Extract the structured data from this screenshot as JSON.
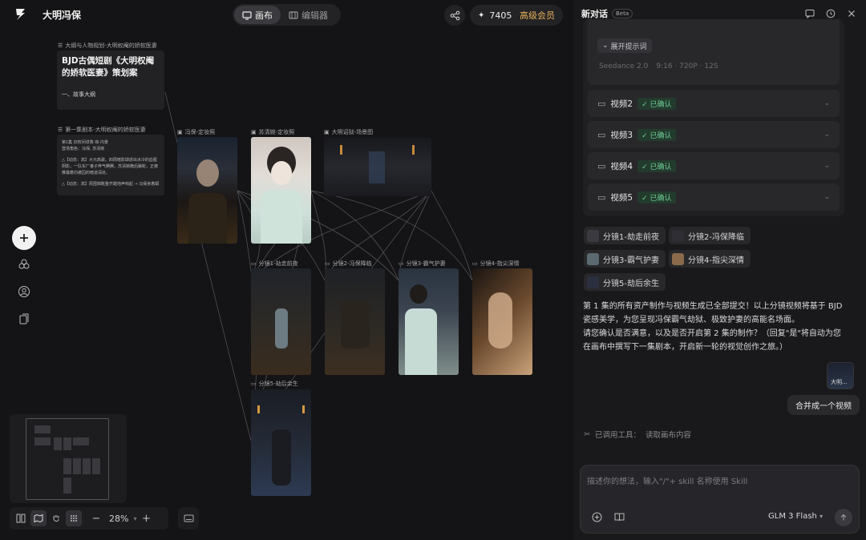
{
  "app": {
    "project_title": "大明冯保",
    "mode_tabs": [
      "画布",
      "编辑器"
    ],
    "credits": "7405",
    "vip_label": "高级会员",
    "zoom": "28%"
  },
  "nodes": {
    "doc1_label": "大纲与人物规划-大明权阉的娇软医妻",
    "doc1_title": "BJD古偶短剧《大明权阉的娇软医妻》策划案",
    "doc1_sub": "一、故事大纲",
    "doc2_label": "第一集剧本-大明权阉的娇软医妻",
    "doc2_lines": [
      "第1集 旧权间谍救·夜·内景",
      "登场角色：冯保, 苏清婉",
      "",
      "△【动态：高】大元高歌。四周暗影肆虐出冰冷的血腥阴影，一队东厂番子奔气腾腾，苏清婉跪后踉跄，正被推搡着向被囚的暗道深处。",
      "",
      "△【动态：高】周围锦靴整齐踏地声响起 → 冯保身着蟒"
    ],
    "img1_label": "冯保-定妆照",
    "img2_label": "苏清婉-定妆照",
    "img3_label": "大明诏狱-场景图",
    "shot1_label": "分镜1-劫走前夜",
    "shot2_label": "分镜2-冯保降临",
    "shot3_label": "分镜3-霸气护妻",
    "shot4_label": "分镜4-指尖深情",
    "shot5_label": "分镜5-劫后余生"
  },
  "chat": {
    "title": "新对话",
    "beta": "Beta",
    "expand_prompt": "展开提示词",
    "model_info": [
      "Seedance 2.0",
      "9:16 · 720P · 12S"
    ],
    "videos": [
      {
        "name": "视频2",
        "status": "已确认"
      },
      {
        "name": "视频3",
        "status": "已确认"
      },
      {
        "name": "视频4",
        "status": "已确认"
      },
      {
        "name": "视频5",
        "status": "已确认"
      }
    ],
    "shot_chips": [
      "分镜1-劫走前夜",
      "分镜2-冯保降临",
      "分镜3-霸气护妻",
      "分镜4-指尖深情",
      "分镜5-劫后余生"
    ],
    "assistant_msg_1": "第 1 集的所有资产制作与视频生成已全部提交！以上分镜视频将基于 BJD 瓷感美学，为您呈现冯保霸气劫狱、极致护妻的高能名场面。",
    "assistant_msg_2": "请您确认是否满意，以及是否开启第 2 集的制作？（回复\"是\"将自动为您在画布中撰写下一集剧本，开启新一轮的视觉创作之旅。）",
    "user_thumb_label": "大明...",
    "user_msg": "合并成一个视频",
    "tool_used_label": "已调用工具：",
    "tool_used_value": "读取画布内容",
    "input_placeholder": "描述你的想法，输入\"/\"+ skill 名称使用 Skill",
    "model_select": "GLM 3 Flash"
  }
}
